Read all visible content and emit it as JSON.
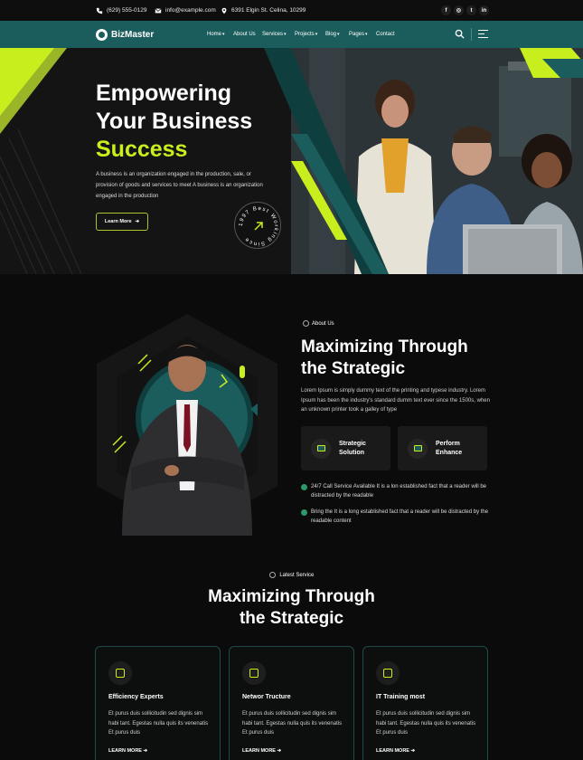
{
  "topbar": {
    "phone": "(629) 555-0129",
    "email": "info@example.com",
    "address": "6391 Elgin St. Celina, 10299",
    "social": [
      "f",
      "◎",
      "t",
      "in"
    ]
  },
  "nav": {
    "logo": "BizMaster",
    "items": [
      "Home",
      "About Us",
      "Services",
      "Projects",
      "Blog",
      "Pages",
      "Contact"
    ],
    "dropdown_marks": [
      "▾",
      "",
      "▾",
      "▾",
      "▾",
      "▾",
      ""
    ]
  },
  "hero": {
    "title_line1": "Empowering",
    "title_line2": "Your Business",
    "title_accent": "Success",
    "description": "A business is an organization engaged in the production, sale, or provision of goods and services to meet A business is an organization engaged in the production",
    "button": "Learn More",
    "badge_text": "1997 Best Working Since"
  },
  "about": {
    "label": "About Us",
    "title_line1": "Maximizing Through",
    "title_line2": "the Strategic",
    "description": "Lorem Ipsum is simply dummy text of the printing and typese industry. Lorem Ipsum has been the industry's standard dumm text ever since the 1500s, when an unknown printer took a galley of type",
    "features": [
      {
        "label": "Strategic Solution"
      },
      {
        "label": "Perform Enhance"
      }
    ],
    "checks": [
      "24/7 Call Service Available It is a lon established fact that a reader will be distracted by the readable",
      "Bring the It is a long established fact that a reader will be distracted by the readable content"
    ]
  },
  "services": {
    "label": "Latest Service",
    "title_line1": "Maximizing Through",
    "title_line2": "the Strategic",
    "cards": [
      {
        "name": "Efficiency Experts",
        "desc": "Et purus duis sollicitudin sed dignis sim habi tant. Egestas nulla quis its venenatis Et purus duis",
        "link": "LEARN MORE"
      },
      {
        "name": "Networ Tructure",
        "desc": "Et purus duis sollicitudin sed dignis sim habi tant. Egestas nulla quis its venenatis Et purus duis",
        "link": "LEARN MORE"
      },
      {
        "name": "IT Training most",
        "desc": "Et purus duis sollicitudin sed dignis sim habi tant. Egestas nulla quis its venenatis Et purus duis",
        "link": "LEARN MORE"
      }
    ]
  },
  "colors": {
    "accent": "#c8ee1e",
    "teal": "#1b5d5d",
    "background": "#0b0b0b"
  }
}
